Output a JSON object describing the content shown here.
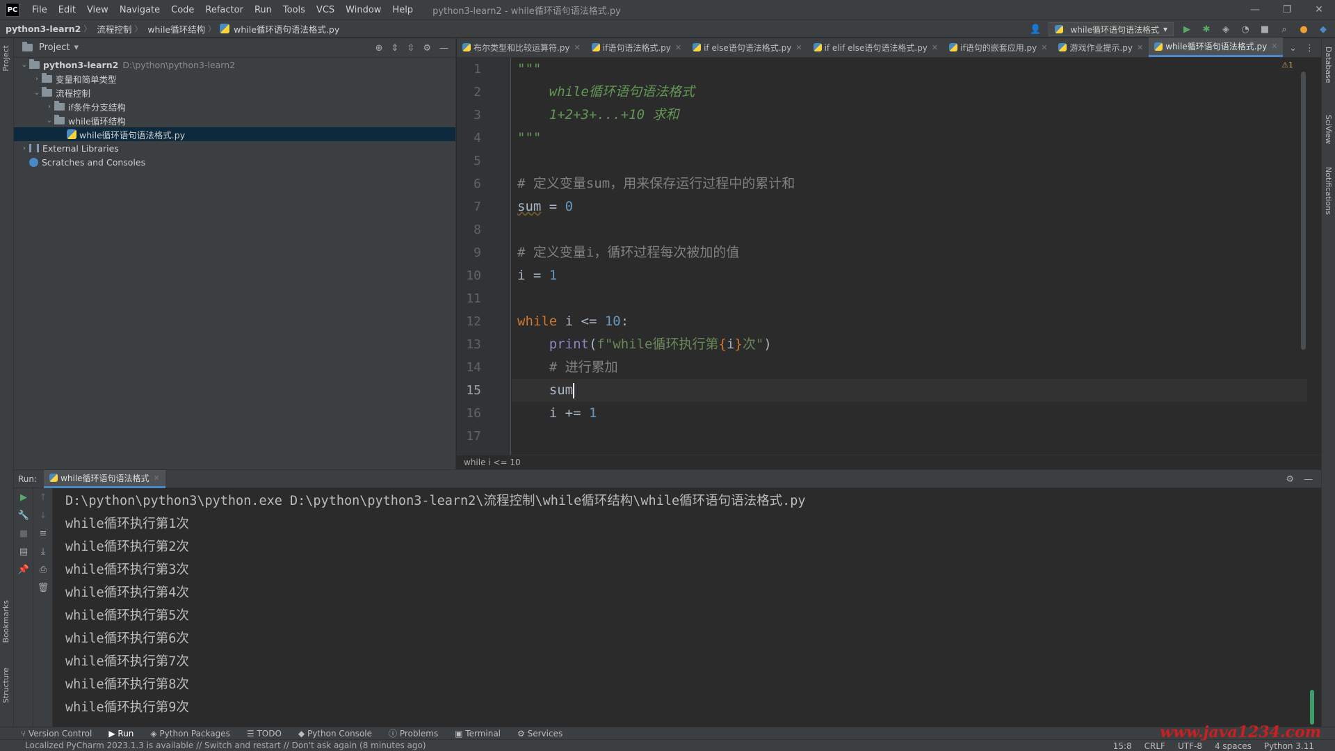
{
  "app": {
    "logo": "PC",
    "menu": [
      "File",
      "Edit",
      "View",
      "Navigate",
      "Code",
      "Refactor",
      "Run",
      "Tools",
      "VCS",
      "Window",
      "Help"
    ],
    "window_title": "python3-learn2 - while循环语句语法格式.py",
    "window_controls": [
      "—",
      "❐",
      "✕"
    ]
  },
  "navbar": {
    "crumbs": [
      "python3-learn2",
      "流程控制",
      "while循环结构",
      "while循环语句语法格式.py"
    ],
    "run_config": "while循环语句语法格式"
  },
  "project": {
    "title": "Project",
    "tree": [
      {
        "label": "python3-learn2",
        "path": "D:\\python\\python3-learn2",
        "type": "folder",
        "expanded": true,
        "depth": 0
      },
      {
        "label": "变量和简单类型",
        "type": "folder",
        "expanded": false,
        "depth": 1
      },
      {
        "label": "流程控制",
        "type": "folder",
        "expanded": true,
        "depth": 1
      },
      {
        "label": "if条件分支结构",
        "type": "folder",
        "expanded": false,
        "depth": 2
      },
      {
        "label": "while循环结构",
        "type": "folder",
        "expanded": true,
        "depth": 2
      },
      {
        "label": "while循环语句语法格式.py",
        "type": "py",
        "depth": 3,
        "selected": true
      },
      {
        "label": "External Libraries",
        "type": "lib",
        "expanded": false,
        "depth": 0
      },
      {
        "label": "Scratches and Consoles",
        "type": "scratch",
        "depth": 0
      }
    ]
  },
  "editor": {
    "tabs": [
      {
        "label": "布尔类型和比较运算符.py",
        "active": false
      },
      {
        "label": "if语句语法格式.py",
        "active": false
      },
      {
        "label": "if else语句语法格式.py",
        "active": false
      },
      {
        "label": "if elif else语句语法格式.py",
        "active": false
      },
      {
        "label": "if语句的嵌套应用.py",
        "active": false
      },
      {
        "label": "游戏作业提示.py",
        "active": false
      },
      {
        "label": "while循环语句语法格式.py",
        "active": true
      }
    ],
    "warning_badge": "⚠1",
    "current_line": 15,
    "lines": [
      "\"\"\"",
      "    while循环语句语法格式",
      "    1+2+3+...+10 求和",
      "\"\"\"",
      "",
      "# 定义变量sum，用来保存运行过程中的累计和",
      "sum = 0",
      "",
      "# 定义变量i，循环过程每次被加的值",
      "i = 1",
      "",
      "while i <= 10:",
      "    print(f\"while循环执行第{i}次\")",
      "    # 进行累加",
      "    sum",
      "    i += 1",
      ""
    ],
    "breadcrumb": "while i <= 10"
  },
  "run": {
    "label": "Run:",
    "tab": "while循环语句语法格式",
    "output": [
      "D:\\python\\python3\\python.exe D:\\python\\python3-learn2\\流程控制\\while循环结构\\while循环语句语法格式.py",
      "while循环执行第1次",
      "while循环执行第2次",
      "while循环执行第3次",
      "while循环执行第4次",
      "while循环执行第5次",
      "while循环执行第6次",
      "while循环执行第7次",
      "while循环执行第8次",
      "while循环执行第9次"
    ]
  },
  "side_tabs": {
    "left": [
      "Project",
      "Bookmarks",
      "Structure"
    ],
    "right": [
      "Database",
      "SciView",
      "Notifications"
    ]
  },
  "bottom_tools": [
    "Version Control",
    "Run",
    "Python Packages",
    "TODO",
    "Python Console",
    "Problems",
    "Terminal",
    "Services"
  ],
  "status": {
    "message": "Localized PyCharm 2023.1.3 is available // Switch and restart // Don't ask again (8 minutes ago)",
    "position": "15:8",
    "line_sep": "CRLF",
    "encoding": "UTF-8",
    "indent": "4 spaces",
    "interpreter": "Python 3.11"
  },
  "watermark": "www.java1234.com"
}
